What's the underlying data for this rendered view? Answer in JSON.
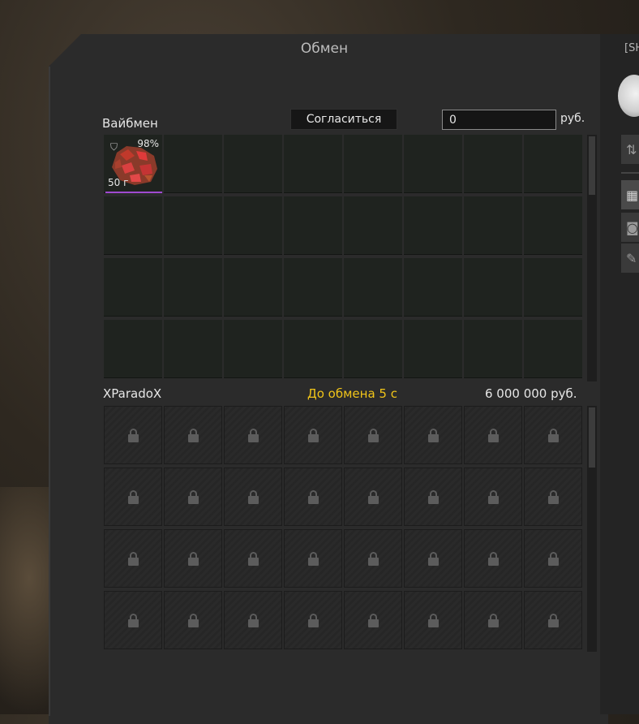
{
  "window": {
    "title": "Обмен"
  },
  "right_panel": {
    "label": "[SH",
    "buttons": [
      {
        "icon": "sort-icon"
      },
      {
        "icon": "grid-view-icon",
        "active": true
      },
      {
        "icon": "camera-icon"
      },
      {
        "icon": "wrench-icon"
      }
    ]
  },
  "mine": {
    "name": "Вайбмен",
    "accept_label": "Согласиться",
    "money_value": "0",
    "currency": "руб.",
    "item": {
      "name": "red-crystal-resource",
      "durability": "98%",
      "weight": "50 г",
      "rarity_color": "#a04ad0"
    }
  },
  "theirs": {
    "name": "XParadoX",
    "timer": "До обмена 5 с",
    "money": "6 000 000 руб."
  },
  "colors": {
    "timer": "#f0c419",
    "accent_rarity": "#a04ad0"
  }
}
